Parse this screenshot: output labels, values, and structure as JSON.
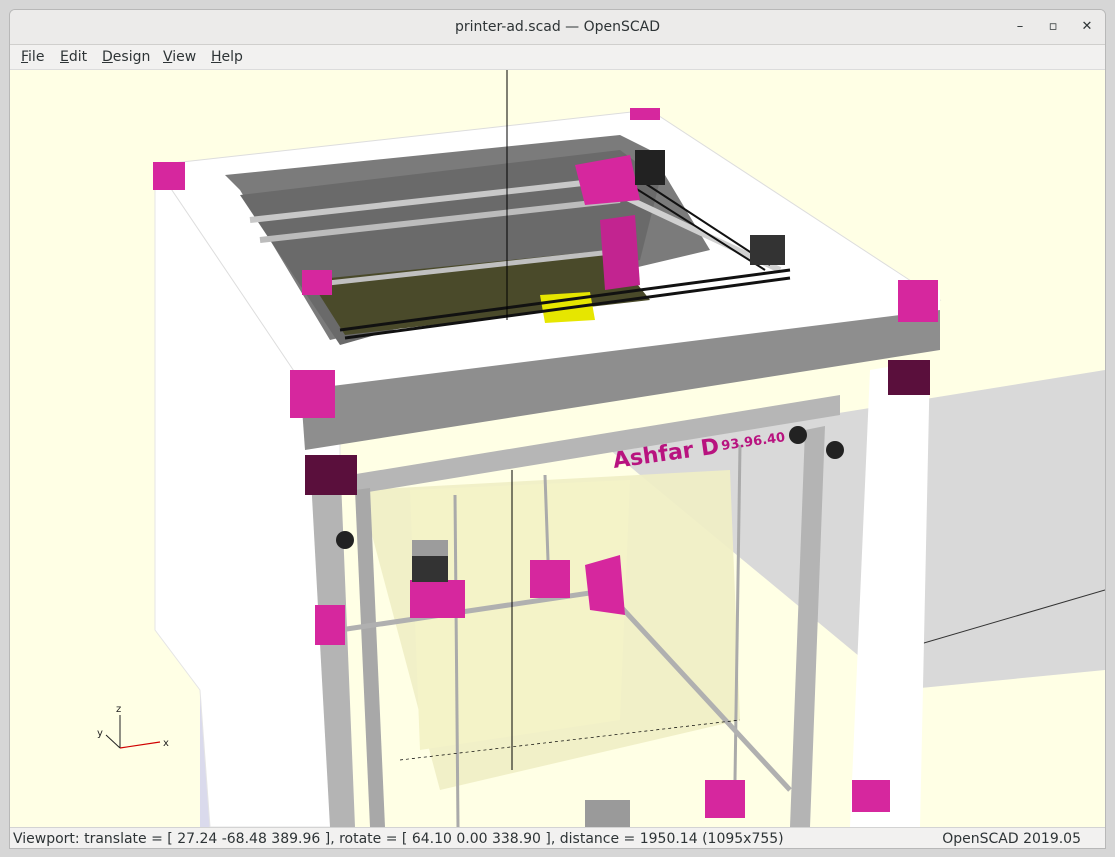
{
  "window": {
    "title": "printer-ad.scad — OpenSCAD",
    "controls": {
      "minimize": "–",
      "maximize": "▫",
      "close": "✕"
    }
  },
  "menu": [
    {
      "accel": "F",
      "rest": "ile"
    },
    {
      "accel": "E",
      "rest": "dit"
    },
    {
      "accel": "D",
      "rest": "esign"
    },
    {
      "accel": "V",
      "rest": "iew"
    },
    {
      "accel": "H",
      "rest": "elp"
    }
  ],
  "viewport": {
    "model_label": "Ashfar D",
    "model_sublabel": "93.96.40",
    "axes": {
      "x": "x",
      "y": "y",
      "z": "z"
    },
    "colors": {
      "background": "#ffffe5",
      "bracket": "#d6279e",
      "bracket_dark": "#5a0f3c",
      "panel": "#ffffff",
      "panel_shade": "#8a8a8a",
      "extrusion": "#b9b9b9",
      "bed": "#6b6b3c",
      "inner_volume": "#f2f0b8"
    }
  },
  "status": {
    "viewport": "Viewport: translate = [ 27.24 -68.48 389.96 ], rotate = [ 64.10 0.00 338.90 ], distance = 1950.14 (1095x755)",
    "version": "OpenSCAD 2019.05"
  }
}
